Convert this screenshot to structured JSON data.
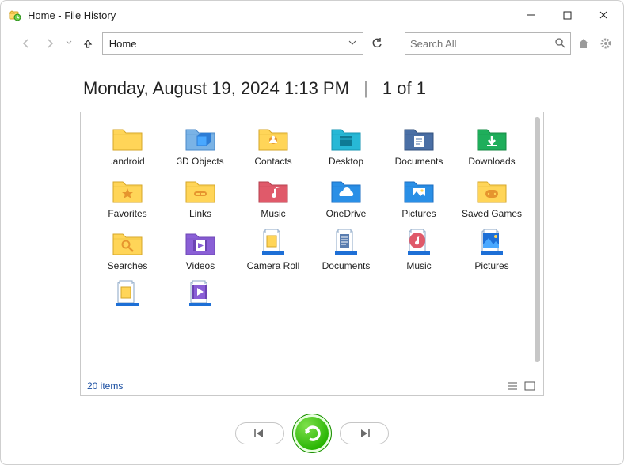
{
  "window": {
    "title": "Home - File History"
  },
  "nav": {
    "path": "Home",
    "search_placeholder": "Search All"
  },
  "header": {
    "datetime": "Monday, August 19, 2024 1:13 PM",
    "page": "1 of 1"
  },
  "items": [
    {
      "label": ".android",
      "icon": "folder-yellow"
    },
    {
      "label": "3D Objects",
      "icon": "folder-3d"
    },
    {
      "label": "Contacts",
      "icon": "folder-contacts"
    },
    {
      "label": "Desktop",
      "icon": "folder-desktop"
    },
    {
      "label": "Documents",
      "icon": "folder-documents"
    },
    {
      "label": "Downloads",
      "icon": "folder-downloads"
    },
    {
      "label": "Favorites",
      "icon": "folder-favorites"
    },
    {
      "label": "Links",
      "icon": "folder-links"
    },
    {
      "label": "Music",
      "icon": "folder-music"
    },
    {
      "label": "OneDrive",
      "icon": "folder-onedrive"
    },
    {
      "label": "Pictures",
      "icon": "folder-pictures"
    },
    {
      "label": "Saved Games",
      "icon": "folder-games"
    },
    {
      "label": "Searches",
      "icon": "folder-searches"
    },
    {
      "label": "Videos",
      "icon": "folder-videos"
    },
    {
      "label": "Camera Roll",
      "icon": "lib-camera"
    },
    {
      "label": "Documents",
      "icon": "lib-documents"
    },
    {
      "label": "Music",
      "icon": "lib-music"
    },
    {
      "label": "Pictures",
      "icon": "lib-pictures"
    },
    {
      "label": "",
      "icon": "lib-blank"
    },
    {
      "label": "",
      "icon": "lib-video"
    }
  ],
  "footer": {
    "count_text": "20 items"
  }
}
